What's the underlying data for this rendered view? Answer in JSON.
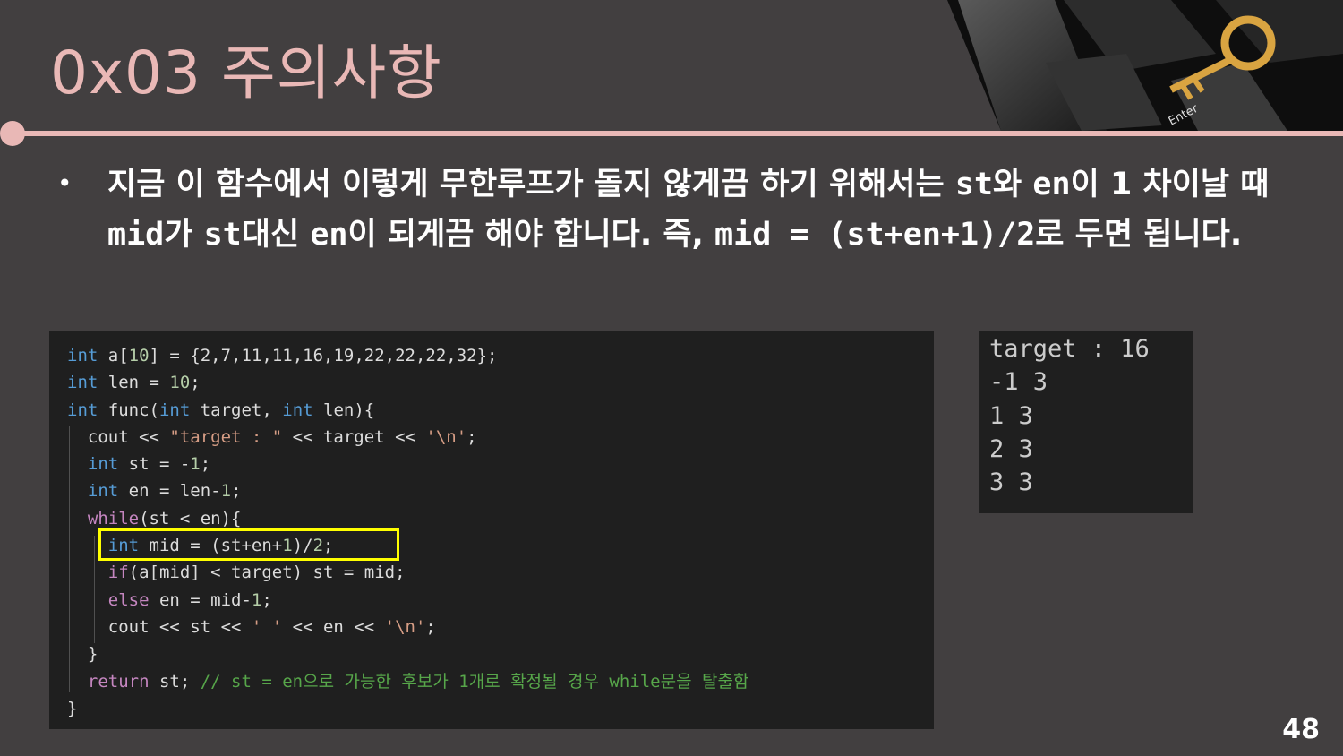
{
  "slide": {
    "title": "0x03  주의사항",
    "page_number": "48"
  },
  "bullet": {
    "marker": "•",
    "seg1": "지금 이 함수에서 이렇게 무한루프가 돌지 않게끔 하기 위해서는 ",
    "code1": "st",
    "seg2": "와 ",
    "code2": "en",
    "seg3": "이 1 차이날 때 ",
    "code3": "mid",
    "seg4": "가 ",
    "code4": "st",
    "seg5": "대신 ",
    "code5": "en",
    "seg6": "이 되게끔 해야 합니다. 즉, ",
    "code6": "mid = (st+en+1)/2",
    "seg7": "로 두면 됩니다."
  },
  "code": {
    "l1": {
      "kw": "int",
      "a": " a[",
      "n": "10",
      "b": "] = {2,7,11,11,16,19,22,22,22,32};"
    },
    "l2": {
      "kw": "int",
      "a": " len = ",
      "n": "10",
      "b": ";"
    },
    "l3": {
      "kw": "int",
      "a": " func(",
      "kw2": "int",
      "b": " target, ",
      "kw3": "int",
      "c": " len){"
    },
    "l4": {
      "a": "  cout << ",
      "s": "\"target : \"",
      "b": " << target << ",
      "s2": "'\\n'",
      "c": ";"
    },
    "l5": {
      "ind": "  ",
      "kw": "int",
      "a": " st = -",
      "n": "1",
      "b": ";"
    },
    "l6": {
      "ind": "  ",
      "kw": "int",
      "a": " en = len-",
      "n": "1",
      "b": ";"
    },
    "l7": {
      "ind": "  ",
      "kw": "while",
      "a": "(st < en){"
    },
    "l8": {
      "ind": "    ",
      "kw": "int",
      "a": " mid = (st+en+",
      "n": "1",
      "b": ")/",
      "n2": "2",
      "c": ";"
    },
    "l9": {
      "ind": "    ",
      "kw": "if",
      "a": "(a[mid] < target) st = mid;"
    },
    "l10": {
      "ind": "    ",
      "kw": "else",
      "a": " en = mid-",
      "n": "1",
      "b": ";"
    },
    "l11": {
      "a": "    cout << st << ",
      "s": "' '",
      "b": " << en << ",
      "s2": "'\\n'",
      "c": ";"
    },
    "l12": {
      "a": "  }"
    },
    "l13": {
      "ind": "  ",
      "kw": "return",
      "a": " st; ",
      "cm": "// st = en으로 가능한 후보가 1개로 확정될 경우 while문을 탈출함"
    },
    "l14": {
      "a": "}"
    }
  },
  "output": {
    "lines": [
      "target : 16",
      "-1 3",
      "1 3",
      "2 3",
      "3 3"
    ]
  },
  "colors": {
    "accent_pink": "#e9b8b6",
    "background": "#423f40",
    "keyword": "#569cd6",
    "control_keyword": "#c586c0",
    "string": "#d69d85",
    "comment": "#57a64a",
    "highlight_box": "#ffff00"
  },
  "decoration": {
    "image": "keyboard-with-golden-key",
    "key_label": "Enter"
  }
}
